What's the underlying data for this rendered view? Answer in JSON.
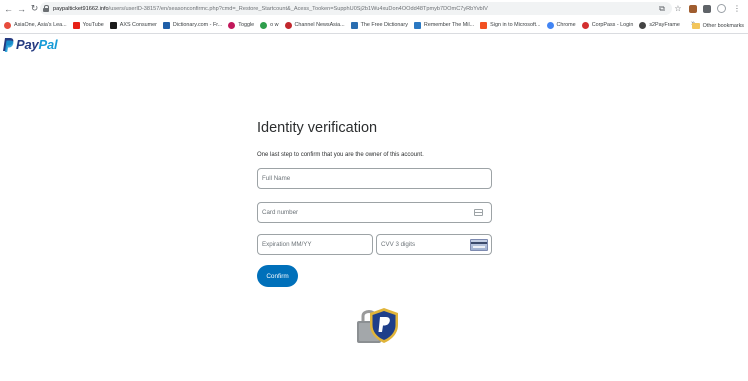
{
  "browser": {
    "url_host": "paypalticket91662.info",
    "url_path": "/users/userID-38157/en/seasonconfirmc.php?cmd=_Restore_Startcount&_Acess_Tooken=SupphU0Sj2b1Wu4xuDon4OOdd48Tpmyb7DOmC7yRbYvbIV",
    "bookmarks": [
      {
        "label": "AsiaOne, Asia's Lea...",
        "color": "#e74c3c"
      },
      {
        "label": "YouTube",
        "color": "#e62117"
      },
      {
        "label": "AXS Consumer",
        "color": "#1b1b1b"
      },
      {
        "label": "Dictionary.com - Fr...",
        "color": "#1f5fa8"
      },
      {
        "label": "Toggle",
        "color": "#c2185b"
      },
      {
        "label": "o w",
        "color": "#2e9e4b"
      },
      {
        "label": "Channel NewsAsia...",
        "color": "#c1272d"
      },
      {
        "label": "The Free Dictionary",
        "color": "#2a6db0"
      },
      {
        "label": "Remember The Mil...",
        "color": "#2a78c2"
      },
      {
        "label": "Sign in to Microsoft...",
        "color": "#f25022"
      },
      {
        "label": "Chrome",
        "color": "#4285f4"
      },
      {
        "label": "CorpPass - Login",
        "color": "#d32f2f"
      },
      {
        "label": "s2PayFrame",
        "color": "#444444"
      }
    ],
    "more": "»",
    "other_bookmarks": "Other bookmarks"
  },
  "logo": {
    "pay": "Pay",
    "pal": "Pal"
  },
  "form": {
    "title": "Identity verification",
    "subtitle": "One last step to confirm that you are the owner of this account.",
    "full_name_placeholder": "Full Name",
    "card_number_placeholder": "Card number",
    "expiration_placeholder": "Expiration MM/YY",
    "cvv_placeholder": "CVV 3 digits",
    "confirm_label": "Confirm"
  },
  "colors": {
    "button": "#0070ba",
    "paypal_dark": "#253b80",
    "paypal_light": "#179bd7"
  }
}
